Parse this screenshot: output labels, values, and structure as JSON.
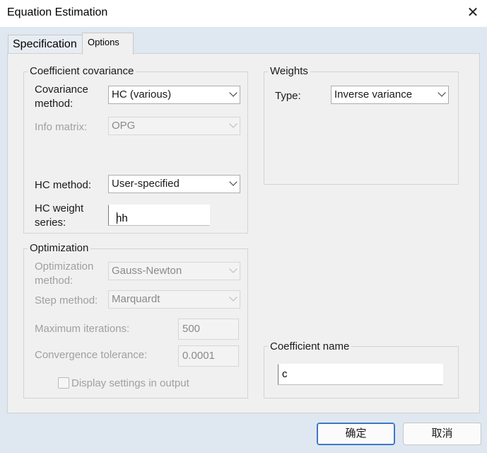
{
  "window": {
    "title": "Equation Estimation",
    "close_glyph": "✕"
  },
  "tabs": [
    {
      "label": "Specification"
    },
    {
      "label": "Options"
    }
  ],
  "covariance": {
    "legend": "Coefficient covariance",
    "method_label_line1": "Covariance",
    "method_label_line2": "method:",
    "method_value": "HC (various)",
    "info_label": "Info matrix:",
    "info_value": "OPG",
    "hc_method_label": "HC method:",
    "hc_method_value": "User-specified",
    "hc_weight_label_line1": "HC weight",
    "hc_weight_label_line2": "series:",
    "hc_weight_value": "hh"
  },
  "weights": {
    "legend": "Weights",
    "type_label": "Type:",
    "type_value": "Inverse variance"
  },
  "optimization": {
    "legend": "Optimization",
    "method_label_line1": "Optimization",
    "method_label_line2": "method:",
    "method_value": "Gauss-Newton",
    "step_label": "Step method:",
    "step_value": "Marquardt",
    "max_iter_label": "Maximum iterations:",
    "max_iter_value": "500",
    "tolerance_label": "Convergence tolerance:",
    "tolerance_value": "0.0001",
    "display_settings_label": "Display settings in output"
  },
  "coef_name": {
    "legend": "Coefficient name",
    "value": "c"
  },
  "buttons": {
    "ok": "确定",
    "cancel": "取消"
  }
}
